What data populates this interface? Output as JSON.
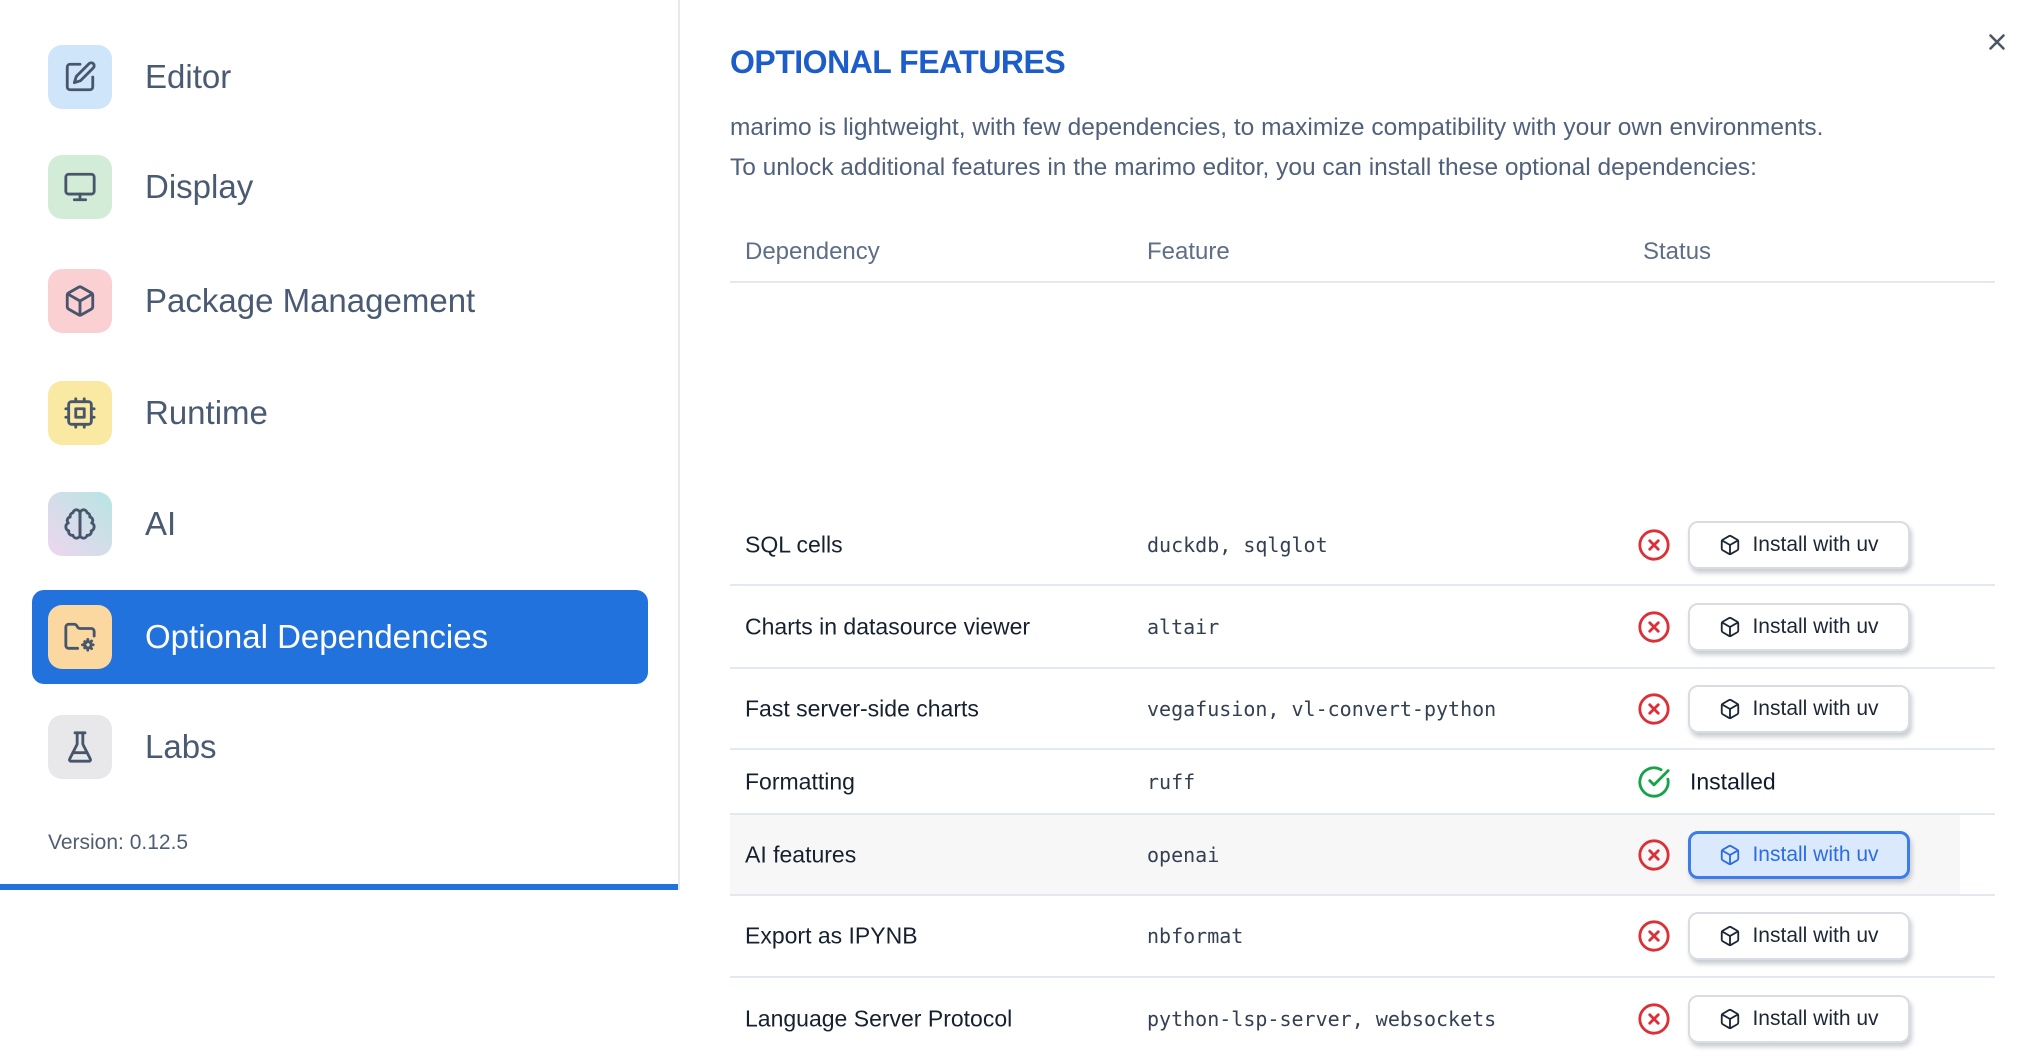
{
  "sidebar": {
    "items": [
      {
        "label": "Editor",
        "icon": "edit-icon",
        "icon_bg": "#cfe5fa",
        "selected": false
      },
      {
        "label": "Display",
        "icon": "monitor-icon",
        "icon_bg": "#d3ecd8",
        "selected": false
      },
      {
        "label": "Package Management",
        "icon": "package-icon",
        "icon_bg": "#fbd0d3",
        "selected": false
      },
      {
        "label": "Runtime",
        "icon": "cpu-icon",
        "icon_bg": "#fae9a2",
        "selected": false
      },
      {
        "label": "AI",
        "icon": "brain-icon",
        "icon_bg": "linear-gradient(45deg,#eed6ee,#b7e5e3)",
        "selected": false
      },
      {
        "label": "Optional Dependencies",
        "icon": "folder-cog-icon",
        "icon_bg": "#fbd8a0",
        "selected": true
      },
      {
        "label": "Labs",
        "icon": "flask-icon",
        "icon_bg": "#e8e8eb",
        "selected": false
      }
    ],
    "version_label": "Version: 0.12.5"
  },
  "panel": {
    "title": "OPTIONAL FEATURES",
    "description_lines": [
      "marimo is lightweight, with few dependencies, to maximize compatibility with your own environments.",
      "To unlock additional features in the marimo editor, you can install these optional dependencies:"
    ],
    "close_icon": "close-icon"
  },
  "table": {
    "columns": [
      "Dependency",
      "Feature",
      "Status"
    ],
    "install_button_label": "Install with uv",
    "installed_label": "Installed",
    "rows": [
      {
        "dependency": "SQL cells",
        "feature": "duckdb, sqlglot",
        "installed": false,
        "highlighted": false
      },
      {
        "dependency": "Charts in datasource viewer",
        "feature": "altair",
        "installed": false,
        "highlighted": false
      },
      {
        "dependency": "Fast server-side charts",
        "feature": "vegafusion, vl-convert-python",
        "installed": false,
        "highlighted": false
      },
      {
        "dependency": "Formatting",
        "feature": "ruff",
        "installed": true,
        "highlighted": false
      },
      {
        "dependency": "AI features",
        "feature": "openai",
        "installed": false,
        "highlighted": true
      },
      {
        "dependency": "Export as IPYNB",
        "feature": "nbformat",
        "installed": false,
        "highlighted": false
      },
      {
        "dependency": "Language Server Protocol",
        "feature": "python-lsp-server, websockets",
        "installed": false,
        "highlighted": false
      }
    ]
  },
  "colors": {
    "accent_blue": "#2272dd",
    "title_blue": "#1d5dc9",
    "error_red": "#dc3038",
    "success_green": "#16a34a",
    "highlight_button_blue": "#2b6ce2"
  }
}
